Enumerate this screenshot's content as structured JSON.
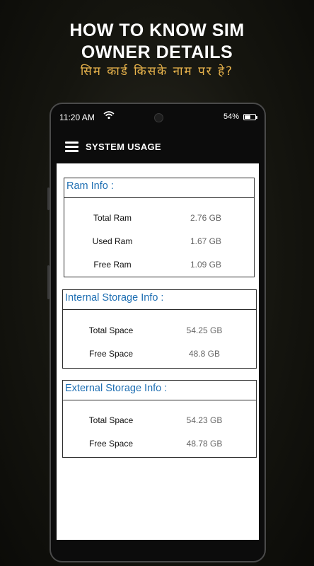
{
  "promo": {
    "title_line1": "HOW TO KNOW SIM",
    "title_line2": "OWNER DETAILS",
    "subtitle": "सिम कार्ड किसके नाम पर हे?"
  },
  "status_bar": {
    "time": "11:20 AM",
    "battery_text": "54%",
    "battery_level": 0.54
  },
  "toolbar": {
    "title": "SYSTEM USAGE"
  },
  "ram": {
    "header": "Ram Info :",
    "rows": [
      {
        "label": "Total Ram",
        "value": "2.76 GB"
      },
      {
        "label": "Used Ram",
        "value": "1.67 GB"
      },
      {
        "label": "Free Ram",
        "value": "1.09 GB"
      }
    ]
  },
  "internal": {
    "header": "Internal Storage Info :",
    "rows": [
      {
        "label": "Total Space",
        "value": "54.25 GB"
      },
      {
        "label": "Free Space",
        "value": "48.8 GB"
      }
    ]
  },
  "external": {
    "header": "External Storage Info :",
    "rows": [
      {
        "label": "Total Space",
        "value": "54.23 GB"
      },
      {
        "label": "Free Space",
        "value": "48.78 GB"
      }
    ]
  },
  "colors": {
    "header_text": "#1f6fb3",
    "subtitle": "#e9b44c"
  }
}
